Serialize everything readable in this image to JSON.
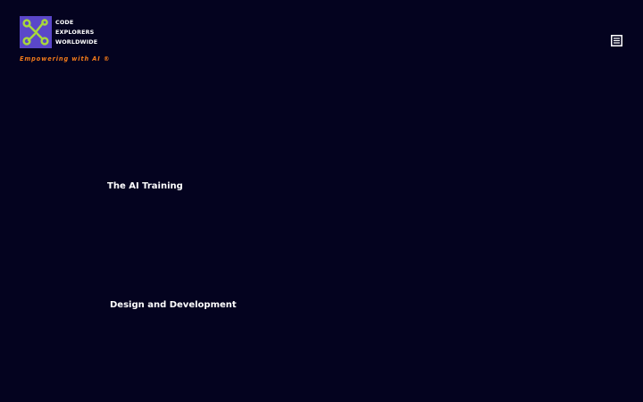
{
  "brand": {
    "name_lines": [
      "CODE",
      "EXPLORERS",
      "WORLDWIDE"
    ],
    "tagline": "Empowering with AI ®",
    "logo_icon": "circuit-nodes-icon",
    "colors": {
      "logo_background": "#5a47c9",
      "logo_circuit": "#a8d83c",
      "tagline": "#f27a1a"
    }
  },
  "header": {
    "menu_icon": "menu-icon"
  },
  "sections": [
    {
      "title": "The AI Training"
    },
    {
      "title": "Design and Development"
    }
  ],
  "theme": {
    "background": "#04031f",
    "text": "#ffffff"
  }
}
